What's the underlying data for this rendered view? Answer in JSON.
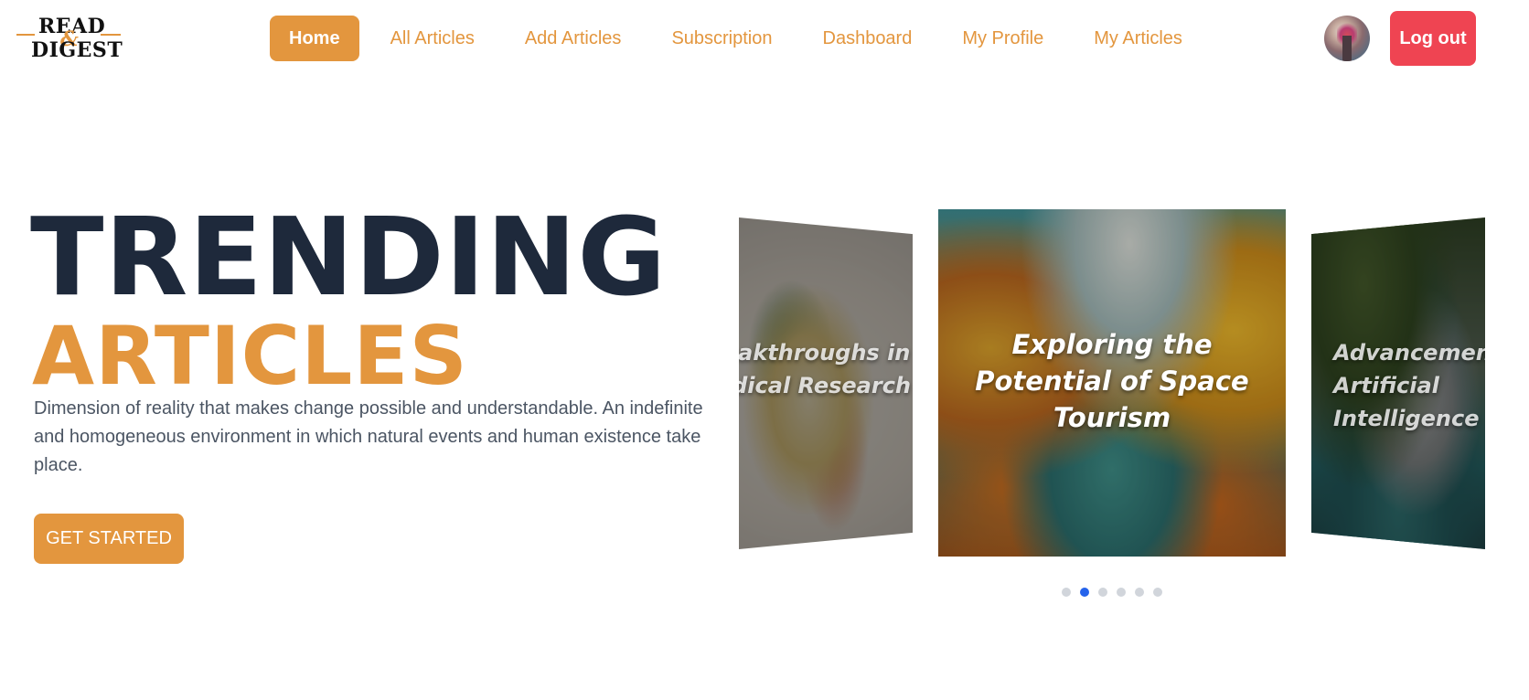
{
  "brand": {
    "logo_top": "READ",
    "logo_amp": "&",
    "logo_bottom": "DIGEST"
  },
  "nav": {
    "items": [
      {
        "label": "Home",
        "active": true
      },
      {
        "label": "All Articles",
        "active": false
      },
      {
        "label": "Add Articles",
        "active": false
      },
      {
        "label": "Subscription",
        "active": false
      },
      {
        "label": "Dashboard",
        "active": false
      },
      {
        "label": "My Profile",
        "active": false
      },
      {
        "label": "My Articles",
        "active": false
      }
    ],
    "avatar_icon": "user-avatar",
    "logout_label": "Log out"
  },
  "hero": {
    "title_line1": "TRENDING",
    "title_line2": "ARTICLES",
    "description": "Dimension of reality that makes change possible and understandable. An indefinite and homogeneous environment in which natural events and human existence take place.",
    "cta_label": "GET STARTED"
  },
  "carousel": {
    "slides": [
      {
        "caption": "Breakthroughs in Medical Research",
        "position": "left"
      },
      {
        "caption": "Exploring the Potential of Space Tourism",
        "position": "center"
      },
      {
        "caption": "Advancements in Artificial Intelligence",
        "position": "right"
      }
    ],
    "dot_count": 6,
    "active_dot": 1
  },
  "colors": {
    "accent": "#e3963e",
    "heading": "#1e293b",
    "logout": "#ef4452",
    "active_dot": "#2563eb",
    "inactive_dot": "#d1d5db"
  }
}
